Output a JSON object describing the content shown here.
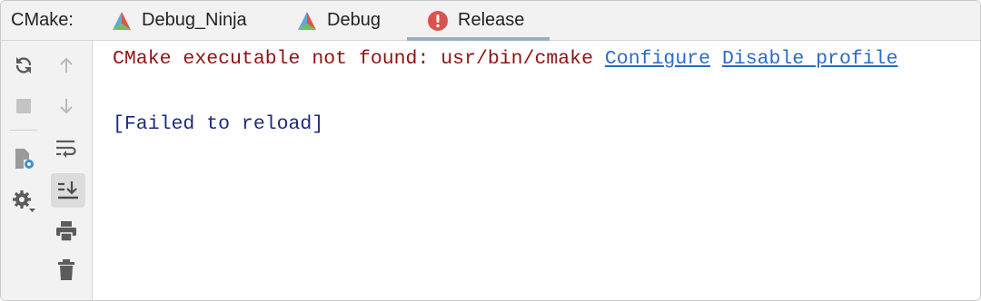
{
  "tabbar": {
    "prefix": "CMake:",
    "tabs": [
      {
        "label": "Debug_Ninja",
        "icon": "cmake-triangle-icon"
      },
      {
        "label": "Debug",
        "icon": "cmake-triangle-icon"
      },
      {
        "label": "Release",
        "icon": "error-icon",
        "active": true
      }
    ]
  },
  "toolbar": {
    "buttons": [
      {
        "name": "reload-icon"
      },
      {
        "name": "scroll-up-icon"
      },
      {
        "name": "stop-icon"
      },
      {
        "name": "scroll-down-icon"
      },
      {
        "name": "settings-file-icon"
      },
      {
        "name": "soft-wrap-icon"
      },
      {
        "name": "gear-dropdown-icon"
      },
      {
        "name": "scroll-to-end-icon",
        "pressed": true
      },
      {
        "name": "print-icon"
      },
      {
        "name": "trash-icon"
      }
    ]
  },
  "console": {
    "error_text": "CMake executable not found: usr/bin/cmake",
    "configure_link": "Configure",
    "disable_link": "Disable profile",
    "status_text": "[Failed to reload]"
  },
  "colors": {
    "error": "#8f1212",
    "link": "#2a6bc4",
    "status": "#1d2a7a",
    "tab_active_underline": "#9aaec6",
    "error_badge": "#d9534f"
  }
}
